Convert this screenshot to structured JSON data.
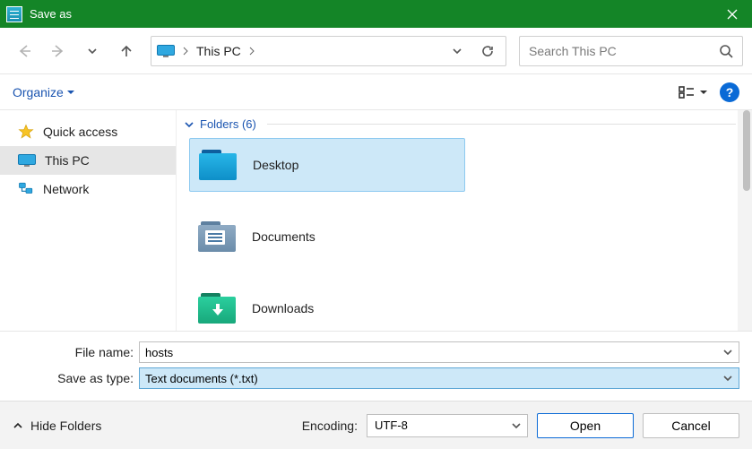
{
  "titlebar": {
    "title": "Save as"
  },
  "nav": {
    "breadcrumb": "This PC",
    "search_placeholder": "Search This PC"
  },
  "toolbar": {
    "organize_label": "Organize",
    "help_label": "?"
  },
  "sidebar": {
    "items": [
      {
        "label": "Quick access",
        "icon": "star-icon",
        "selected": false
      },
      {
        "label": "This PC",
        "icon": "pc-icon",
        "selected": true
      },
      {
        "label": "Network",
        "icon": "network-icon",
        "selected": false
      }
    ]
  },
  "content": {
    "group_label": "Folders (6)",
    "folders": [
      {
        "label": "Desktop",
        "selected": true,
        "colors": {
          "back": "#0e5f9e",
          "front": "#1aa2d8"
        }
      },
      {
        "label": "Documents",
        "selected": false,
        "colors": {
          "back": "#5e80a0",
          "front": "#7ea0be"
        }
      },
      {
        "label": "Downloads",
        "selected": false,
        "colors": {
          "back": "#148060",
          "front": "#1fb389"
        }
      }
    ]
  },
  "form": {
    "file_name_label": "File name:",
    "file_name_value": "hosts",
    "save_type_label": "Save as type:",
    "save_type_value": "Text documents (*.txt)"
  },
  "footer": {
    "hide_folders_label": "Hide Folders",
    "encoding_label": "Encoding:",
    "encoding_value": "UTF-8",
    "open_label": "Open",
    "cancel_label": "Cancel"
  }
}
